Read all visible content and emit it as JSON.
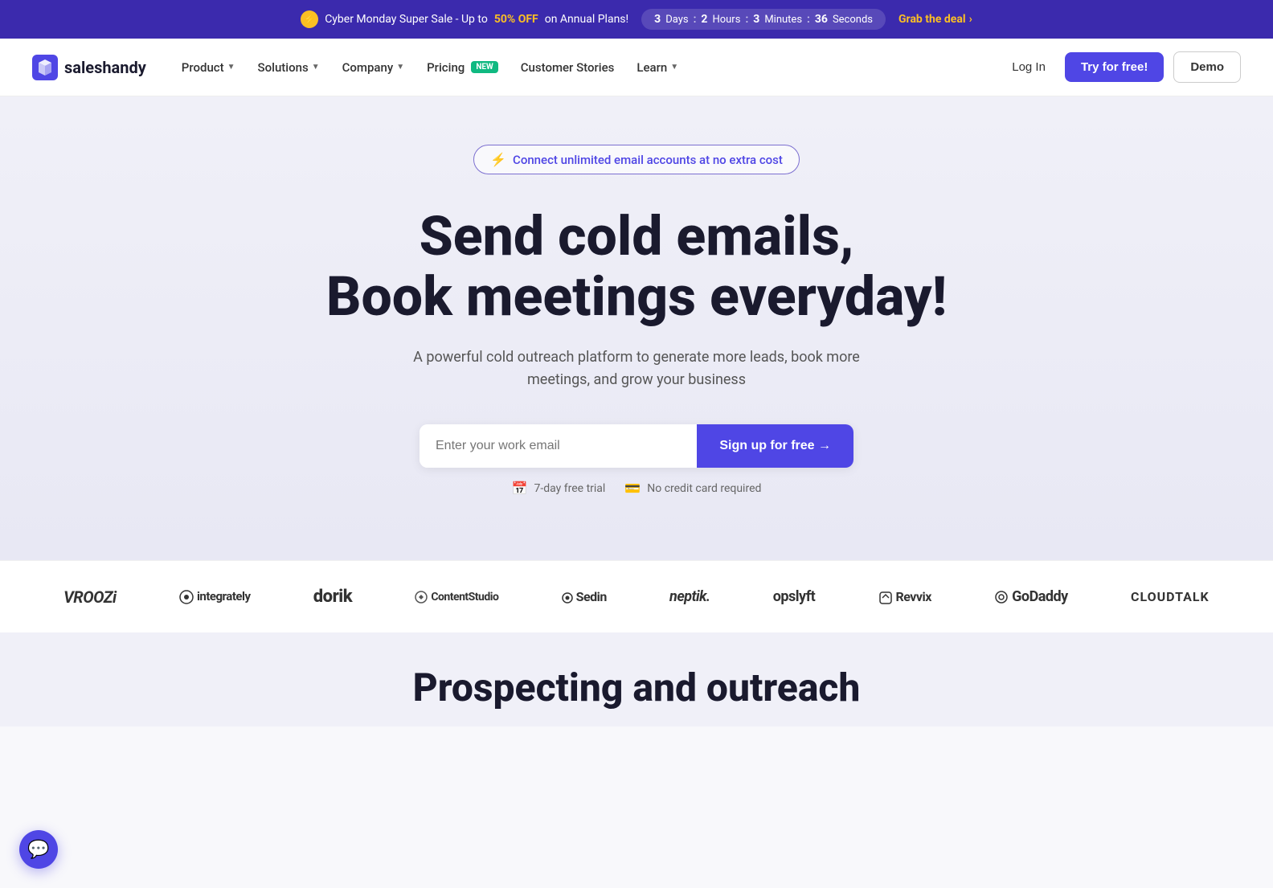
{
  "banner": {
    "lightning_symbol": "⚡",
    "pre_text": "Cyber Monday Super Sale - Up to ",
    "highlight": "50% OFF",
    "post_text": " on Annual Plans!",
    "timer": {
      "days_num": "3",
      "days_label": "Days",
      "hours_num": "2",
      "hours_label": "Hours",
      "minutes_num": "3",
      "minutes_label": "Minutes",
      "seconds_num": "36",
      "seconds_label": "Seconds",
      "sep": ":"
    },
    "cta_text": "Grab the deal",
    "cta_arrow": "›"
  },
  "navbar": {
    "logo_text": "saleshandy",
    "nav_items": [
      {
        "label": "Product",
        "has_dropdown": true
      },
      {
        "label": "Solutions",
        "has_dropdown": true
      },
      {
        "label": "Company",
        "has_dropdown": true
      },
      {
        "label": "Pricing",
        "has_dropdown": false,
        "badge": "NEW"
      },
      {
        "label": "Customer Stories",
        "has_dropdown": false
      },
      {
        "label": "Learn",
        "has_dropdown": true
      }
    ],
    "login_label": "Log In",
    "try_free_label": "Try for free!",
    "demo_label": "Demo"
  },
  "hero": {
    "badge_text": "Connect unlimited email accounts at no extra cost",
    "badge_icon": "⚡",
    "title_line1": "Send cold emails,",
    "title_line2": "Book meetings everyday!",
    "subtitle": "A powerful cold outreach platform to generate more leads, book more meetings, and grow your business",
    "email_placeholder": "Enter your work email",
    "signup_button": "Sign up for free →",
    "trust_items": [
      {
        "icon": "📅",
        "label": "7-day free trial"
      },
      {
        "icon": "💳",
        "label": "No credit card required"
      }
    ]
  },
  "logos": [
    {
      "name": "VROOZi",
      "class": "vroozi"
    },
    {
      "name": "● integrately",
      "class": "integrately"
    },
    {
      "name": "dorik",
      "class": "dorik"
    },
    {
      "name": "● ContentStudio",
      "class": "contentstudio"
    },
    {
      "name": "● Sedin",
      "class": "sedin"
    },
    {
      "name": "neptik.",
      "class": "neptik"
    },
    {
      "name": "opslyft",
      "class": "opslyft"
    },
    {
      "name": "◫ Revvix",
      "class": "revvix"
    },
    {
      "name": "◎ GoDaddy",
      "class": "godaddy"
    },
    {
      "name": "CLOUDTALK",
      "class": "cloudtalk"
    }
  ],
  "bottom_teaser": {
    "title": "Prospecting and outreach"
  },
  "chat": {
    "icon": "💬"
  }
}
